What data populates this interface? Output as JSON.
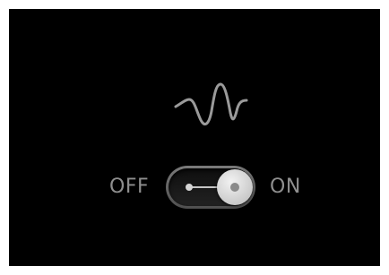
{
  "switch": {
    "off_label": "OFF",
    "on_label": "ON",
    "state": "on",
    "icon": "waveform-icon"
  },
  "colors": {
    "background": "#000000",
    "label": "#8e8e8e",
    "knob": "#d9d9d9",
    "wave": "#9a9a9a"
  }
}
